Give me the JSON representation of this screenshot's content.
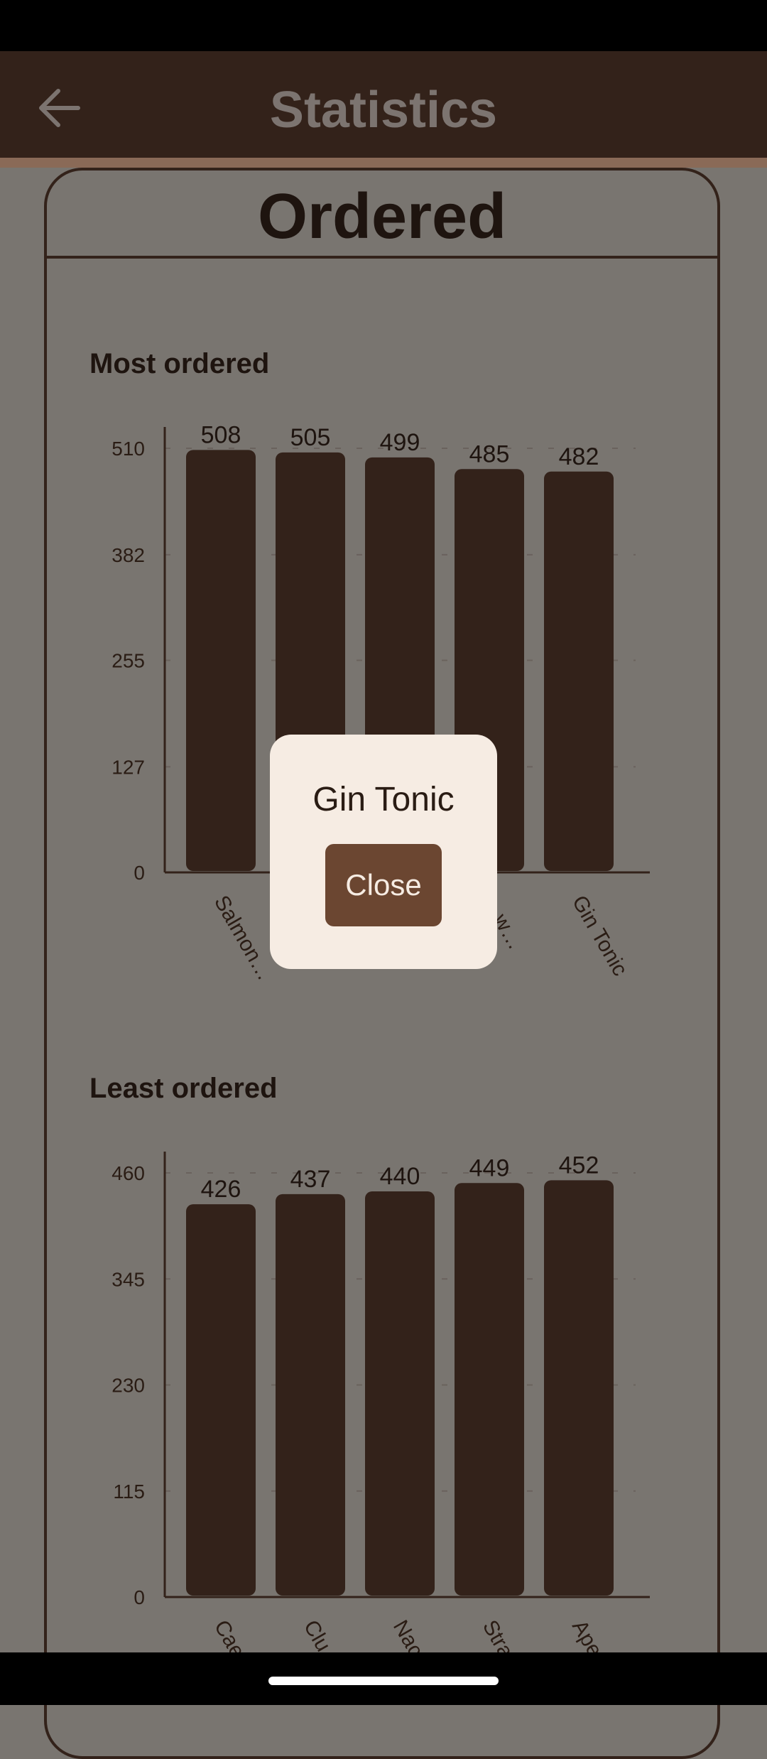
{
  "appbar": {
    "title": "Statistics",
    "back_icon": "arrow-left-icon"
  },
  "card": {
    "title": "Ordered"
  },
  "most_ordered": {
    "title": "Most ordered"
  },
  "least_ordered": {
    "title": "Least ordered"
  },
  "dialog": {
    "text": "Gin Tonic",
    "close_label": "Close"
  },
  "colors": {
    "bar": "#33221a",
    "appbar": "#33221a",
    "dialog_bg": "#f6ece3",
    "button": "#6b4631"
  },
  "chart_data": [
    {
      "type": "bar",
      "title": "Most ordered",
      "categories": [
        "Salmon…",
        "",
        "",
        "…w…",
        "Gin Tonic"
      ],
      "values": [
        508,
        505,
        499,
        485,
        482
      ],
      "yticks": [
        0,
        127,
        255,
        382,
        510
      ],
      "ylim": [
        0,
        510
      ],
      "grid": true
    },
    {
      "type": "bar",
      "title": "Least ordered",
      "categories": [
        "Cae",
        "Clu",
        "Nac",
        "Stra",
        "Ape"
      ],
      "values": [
        426,
        437,
        440,
        449,
        452
      ],
      "yticks": [
        0,
        115,
        230,
        345,
        460
      ],
      "ylim": [
        0,
        460
      ],
      "grid": true
    }
  ]
}
